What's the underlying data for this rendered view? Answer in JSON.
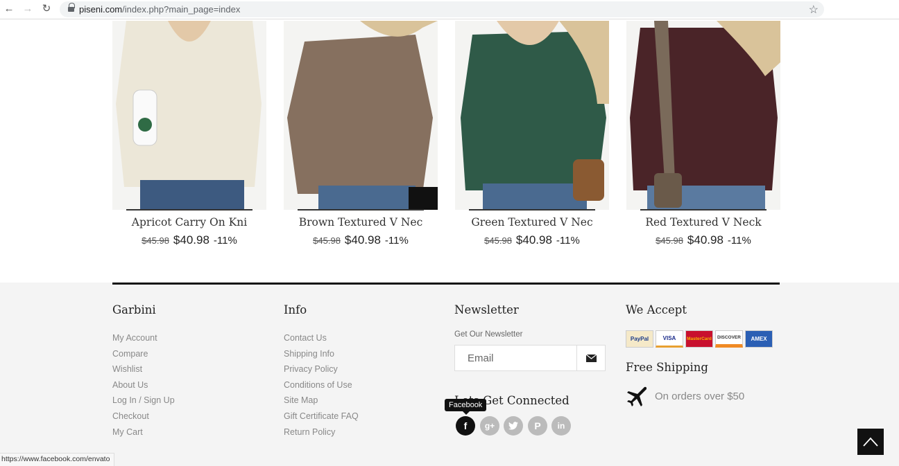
{
  "browser": {
    "url_host": "piseni.com",
    "url_path": "/index.php?main_page=index"
  },
  "products": [
    {
      "name": "Apricot Carry On Kni",
      "old_price": "$45.98",
      "price": "$40.98",
      "discount": "-11%",
      "color": "#ece7d8"
    },
    {
      "name": "Brown Textured V Nec",
      "old_price": "$45.98",
      "price": "$40.98",
      "discount": "-11%",
      "color": "#86705f"
    },
    {
      "name": "Green Textured V Nec",
      "old_price": "$45.98",
      "price": "$40.98",
      "discount": "-11%",
      "color": "#2f5a48"
    },
    {
      "name": "Red Textured V Neck",
      "old_price": "$45.98",
      "price": "$40.98",
      "discount": "-11%",
      "color": "#4a2428"
    }
  ],
  "footer": {
    "garbini": {
      "title": "Garbini",
      "links": [
        "My Account",
        "Compare",
        "Wishlist",
        "About Us",
        "Log In / Sign Up",
        "Checkout",
        "My Cart"
      ]
    },
    "info": {
      "title": "Info",
      "links": [
        "Contact Us",
        "Shipping Info",
        "Privacy Policy",
        "Conditions of Use",
        "Site Map",
        "Gift Certificate FAQ",
        "Return Policy"
      ]
    },
    "newsletter": {
      "title": "Newsletter",
      "label": "Get Our Newsletter",
      "placeholder": "Email",
      "connected_title": "Lets Get Connected",
      "tooltip": "Facebook"
    },
    "accept": {
      "title": "We Accept",
      "cards": [
        "PayPal",
        "VISA",
        "MasterCard",
        "DISCOVER",
        "AMEX"
      ],
      "shipping_title": "Free Shipping",
      "shipping_text": "On orders over $50"
    }
  },
  "status_url": "https://www.facebook.com/envato"
}
